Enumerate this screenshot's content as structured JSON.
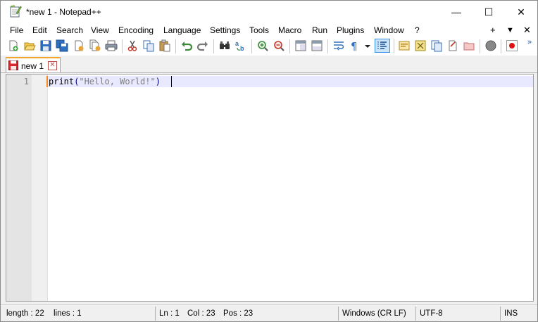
{
  "window": {
    "title": "*new 1 - Notepad++",
    "minimize_glyph": "—",
    "maximize_glyph": "☐",
    "close_glyph": "✕"
  },
  "menu": {
    "items": [
      "File",
      "Edit",
      "Search",
      "View",
      "Encoding",
      "Language",
      "Settings",
      "Tools",
      "Macro",
      "Run",
      "Plugins",
      "Window",
      "?"
    ],
    "right_plus": "+",
    "right_dropdown": "▼",
    "right_close": "✕"
  },
  "toolbar": {
    "icons": [
      "new-file-icon",
      "open-file-icon",
      "save-icon",
      "save-all-icon",
      "close-icon",
      "close-all-icon",
      "print-icon",
      "cut-icon",
      "copy-icon",
      "paste-icon",
      "undo-icon",
      "redo-icon",
      "find-icon",
      "replace-icon",
      "zoom-in-icon",
      "zoom-out-icon",
      "sync-vertical-icon",
      "sync-horizontal-icon",
      "word-wrap-icon",
      "show-all-chars-icon",
      "indent-guide-icon",
      "doc-map-icon",
      "function-list-icon",
      "folder-workspace-icon",
      "doc-list-icon",
      "monitoring-icon",
      "macro-record-icon"
    ],
    "more_glyph": "»"
  },
  "tabs": [
    {
      "label": "new 1",
      "close_glyph": "✕"
    }
  ],
  "editor": {
    "line_number": "1",
    "code_func": "print",
    "code_open": "(",
    "code_string": "\"Hello, World!\"",
    "code_close": ")"
  },
  "status": {
    "length": "length : 22",
    "lines": "lines : 1",
    "ln": "Ln : 1",
    "col": "Col : 23",
    "pos": "Pos : 23",
    "eol": "Windows (CR LF)",
    "encoding": "UTF-8",
    "mode": "INS"
  },
  "colors": {
    "accent_tab": "#f4a62a",
    "current_line": "#e8e8ff"
  }
}
